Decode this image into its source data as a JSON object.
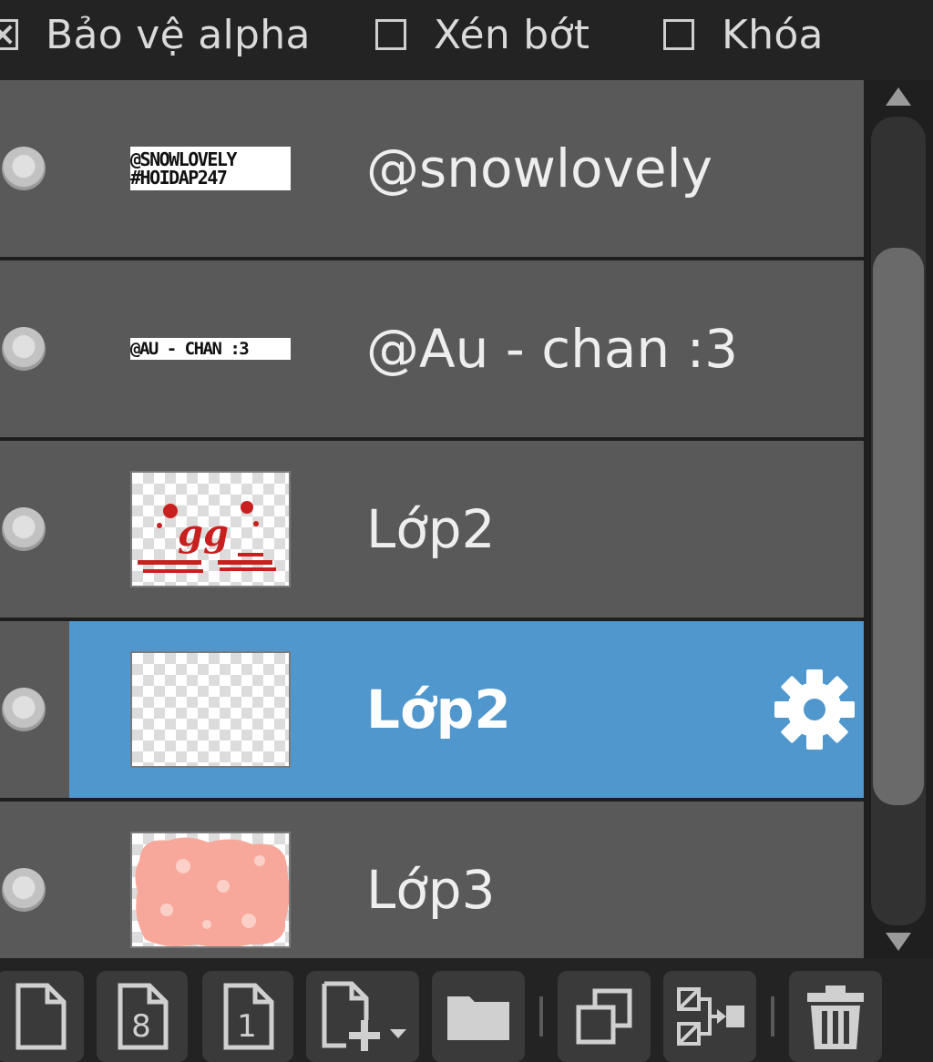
{
  "options": {
    "protect_alpha": {
      "label": "Bảo vệ alpha",
      "checked": true
    },
    "clipping": {
      "label": "Xén bớt",
      "checked": false
    },
    "lock": {
      "label": "Khóa",
      "checked": false
    }
  },
  "layers": [
    {
      "name": "@snowlovely",
      "thumb_type": "text",
      "thumb_lines": [
        "@SNOWLOVELY",
        "#HOIDAP247"
      ],
      "visible": true,
      "selected": false
    },
    {
      "name": "@Au - chan :3",
      "thumb_type": "text",
      "thumb_lines": [
        "@AU - CHAN :3"
      ],
      "visible": true,
      "selected": false
    },
    {
      "name": "Lớp2",
      "thumb_type": "gg",
      "visible": true,
      "selected": false
    },
    {
      "name": "Lớp2",
      "thumb_type": "blank",
      "visible": true,
      "selected": true
    },
    {
      "name": "Lớp3",
      "thumb_type": "pink",
      "visible": true,
      "selected": false
    }
  ],
  "colors": {
    "row_bg": "#595959",
    "selected_bg": "#4f97cd",
    "panel_bg": "#232323"
  },
  "toolbar": {
    "buttons": [
      {
        "icon": "new-layer-icon"
      },
      {
        "icon": "new-8bit-layer-icon",
        "glyph": "8"
      },
      {
        "icon": "new-1bit-layer-icon",
        "glyph": "1"
      },
      {
        "icon": "add-layer-dropdown-icon"
      },
      {
        "icon": "folder-icon"
      },
      {
        "icon": "duplicate-layer-icon"
      },
      {
        "icon": "merge-down-icon"
      },
      {
        "icon": "trash-icon"
      }
    ]
  }
}
